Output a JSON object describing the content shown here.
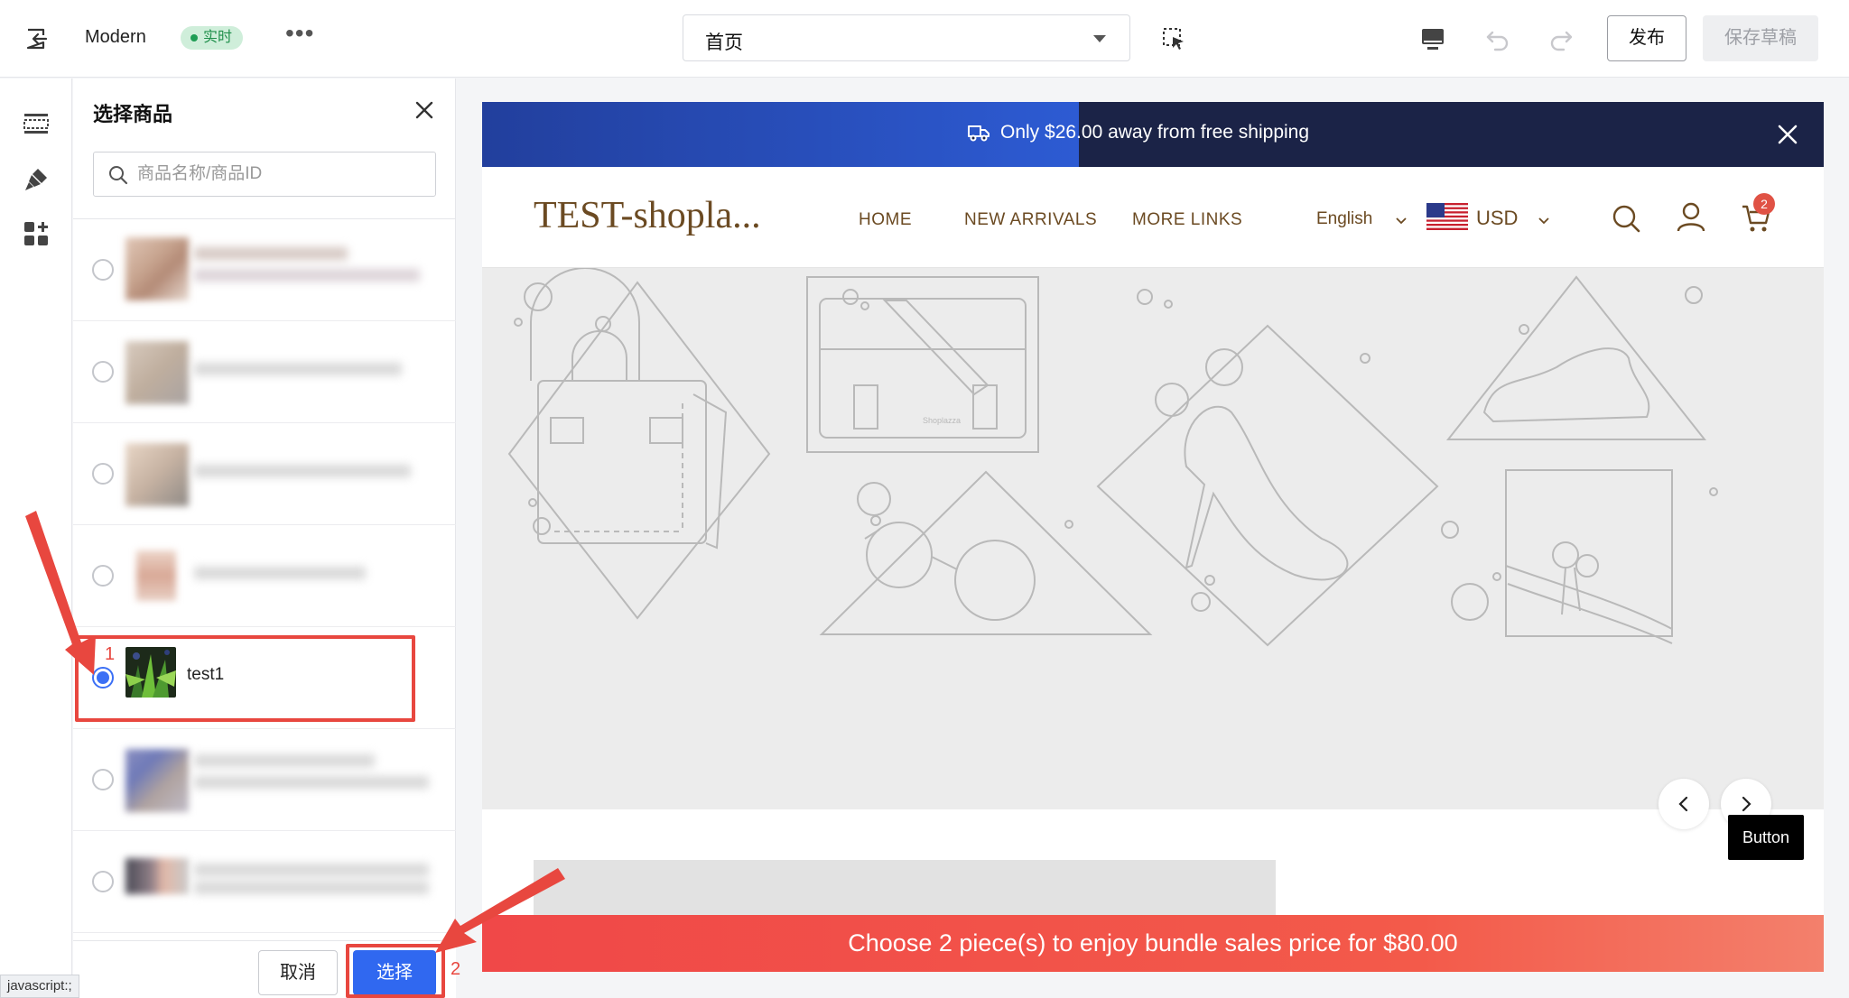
{
  "topbar": {
    "theme_name": "Modern",
    "live_badge": "实时",
    "more_label": "•••",
    "page_select_value": "首页",
    "publish_label": "发布",
    "save_draft_label": "保存草稿"
  },
  "panel": {
    "title": "选择商品",
    "search_placeholder": "商品名称/商品ID",
    "selected_product_name": "test1",
    "cancel_label": "取消",
    "select_label": "选择"
  },
  "annotations": {
    "step1": "1",
    "step2": "2",
    "color": "#e8473f"
  },
  "status_bar_url": "javascript:;",
  "preview": {
    "announcement_text": "Only $26.00 away from free shipping",
    "shipping_progress": 0.445,
    "store_logo": "TEST-shopla...",
    "nav_items": [
      "HOME",
      "NEW ARRIVALS",
      "MORE LINKS"
    ],
    "language": "English",
    "currency": "USD",
    "cart_count": "2",
    "banner_watermark": "Shoplazza",
    "tooltip": "Button",
    "bundle_bar_text": "Choose 2 piece(s) to enjoy bundle sales price for $80.00"
  },
  "colors": {
    "primary_blue": "#3068f0",
    "announce_bg": "#1b2347",
    "store_brown": "#6b4a22",
    "bundle_red": "#f04848",
    "live_green": "#1f8f4b"
  }
}
